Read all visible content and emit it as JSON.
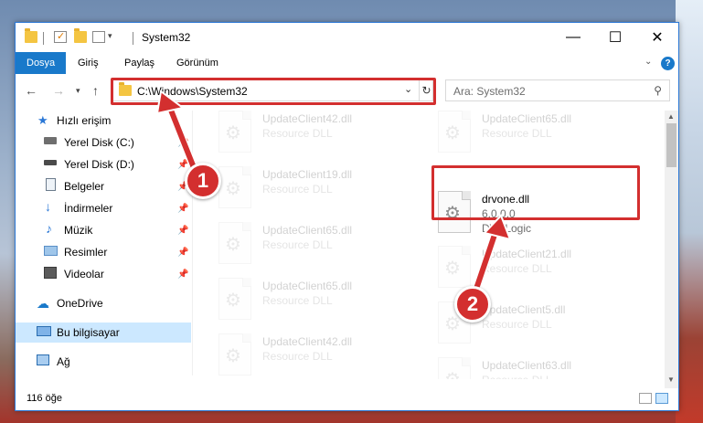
{
  "window": {
    "title": "System32",
    "minimize_symbol": "—",
    "maximize_symbol": "☐",
    "close_symbol": "✕"
  },
  "ribbon": {
    "tabs": [
      "Dosya",
      "Giriş",
      "Paylaş",
      "Görünüm"
    ],
    "active_tab": "Dosya",
    "help_symbol": "?"
  },
  "navigation": {
    "address_path": "C:\\Windows\\System32",
    "search_placeholder": "Ara: System32"
  },
  "sidebar": {
    "items": [
      {
        "label": "Hızlı erişim",
        "icon": "star-icon"
      },
      {
        "label": "Yerel Disk (C:)",
        "icon": "drive-icon",
        "pinned": true
      },
      {
        "label": "Yerel Disk (D:)",
        "icon": "drive-icon",
        "pinned": true
      },
      {
        "label": "Belgeler",
        "icon": "documents-icon",
        "pinned": true
      },
      {
        "label": "İndirmeler",
        "icon": "download-icon",
        "pinned": true
      },
      {
        "label": "Müzik",
        "icon": "music-icon",
        "pinned": true
      },
      {
        "label": "Resimler",
        "icon": "pictures-icon",
        "pinned": true
      },
      {
        "label": "Videolar",
        "icon": "videos-icon",
        "pinned": true
      },
      {
        "label": "OneDrive",
        "icon": "cloud-icon"
      },
      {
        "label": "Bu bilgisayar",
        "icon": "computer-icon",
        "selected": true
      },
      {
        "label": "Ağ",
        "icon": "network-icon"
      }
    ]
  },
  "files": {
    "left_column": [
      {
        "name": "UpdateClient42.dll",
        "type": "Resource DLL"
      },
      {
        "name": "UpdateClient19.dll",
        "type": "Resource DLL"
      },
      {
        "name": "UpdateClient65.dll",
        "type": "Resource DLL"
      },
      {
        "name": "UpdateClient65.dll",
        "type": "Resource DLL"
      },
      {
        "name": "UpdateClient42.dll",
        "type": "Resource DLL"
      }
    ],
    "right_column": [
      {
        "name": "UpdateClient65.dll",
        "type": "Resource DLL"
      },
      {
        "name": "UpdateClient21.dll",
        "type": "Resource DLL"
      },
      {
        "name": "UpdateClient5.dll",
        "type": "Resource DLL"
      },
      {
        "name": "UpdateClient63.dll",
        "type": "Resource DLL"
      }
    ],
    "highlighted": {
      "name": "drvone.dll",
      "version": "6.0.0.0",
      "company": "DVDLogic"
    }
  },
  "status": {
    "item_count": "116 öğe"
  },
  "annotations": {
    "marker_1": "1",
    "marker_2": "2",
    "color": "#d32f2f"
  }
}
